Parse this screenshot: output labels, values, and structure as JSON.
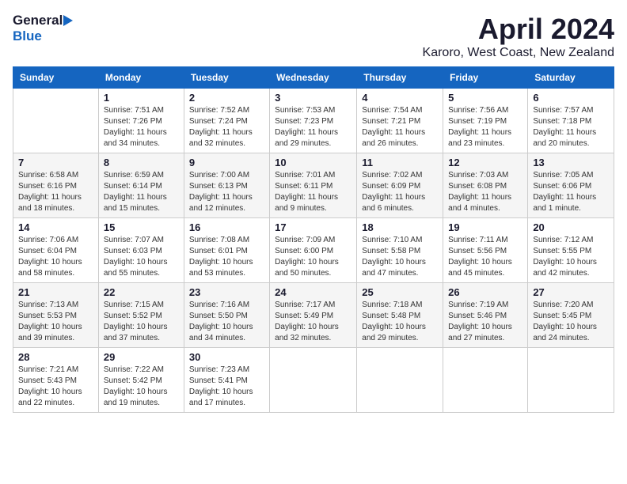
{
  "header": {
    "logo_general": "General",
    "logo_blue": "Blue",
    "month_year": "April 2024",
    "location": "Karoro, West Coast, New Zealand"
  },
  "days_of_week": [
    "Sunday",
    "Monday",
    "Tuesday",
    "Wednesday",
    "Thursday",
    "Friday",
    "Saturday"
  ],
  "weeks": [
    [
      {
        "day": "",
        "sunrise": "",
        "sunset": "",
        "daylight": ""
      },
      {
        "day": "1",
        "sunrise": "Sunrise: 7:51 AM",
        "sunset": "Sunset: 7:26 PM",
        "daylight": "Daylight: 11 hours and 34 minutes."
      },
      {
        "day": "2",
        "sunrise": "Sunrise: 7:52 AM",
        "sunset": "Sunset: 7:24 PM",
        "daylight": "Daylight: 11 hours and 32 minutes."
      },
      {
        "day": "3",
        "sunrise": "Sunrise: 7:53 AM",
        "sunset": "Sunset: 7:23 PM",
        "daylight": "Daylight: 11 hours and 29 minutes."
      },
      {
        "day": "4",
        "sunrise": "Sunrise: 7:54 AM",
        "sunset": "Sunset: 7:21 PM",
        "daylight": "Daylight: 11 hours and 26 minutes."
      },
      {
        "day": "5",
        "sunrise": "Sunrise: 7:56 AM",
        "sunset": "Sunset: 7:19 PM",
        "daylight": "Daylight: 11 hours and 23 minutes."
      },
      {
        "day": "6",
        "sunrise": "Sunrise: 7:57 AM",
        "sunset": "Sunset: 7:18 PM",
        "daylight": "Daylight: 11 hours and 20 minutes."
      }
    ],
    [
      {
        "day": "7",
        "sunrise": "Sunrise: 6:58 AM",
        "sunset": "Sunset: 6:16 PM",
        "daylight": "Daylight: 11 hours and 18 minutes."
      },
      {
        "day": "8",
        "sunrise": "Sunrise: 6:59 AM",
        "sunset": "Sunset: 6:14 PM",
        "daylight": "Daylight: 11 hours and 15 minutes."
      },
      {
        "day": "9",
        "sunrise": "Sunrise: 7:00 AM",
        "sunset": "Sunset: 6:13 PM",
        "daylight": "Daylight: 11 hours and 12 minutes."
      },
      {
        "day": "10",
        "sunrise": "Sunrise: 7:01 AM",
        "sunset": "Sunset: 6:11 PM",
        "daylight": "Daylight: 11 hours and 9 minutes."
      },
      {
        "day": "11",
        "sunrise": "Sunrise: 7:02 AM",
        "sunset": "Sunset: 6:09 PM",
        "daylight": "Daylight: 11 hours and 6 minutes."
      },
      {
        "day": "12",
        "sunrise": "Sunrise: 7:03 AM",
        "sunset": "Sunset: 6:08 PM",
        "daylight": "Daylight: 11 hours and 4 minutes."
      },
      {
        "day": "13",
        "sunrise": "Sunrise: 7:05 AM",
        "sunset": "Sunset: 6:06 PM",
        "daylight": "Daylight: 11 hours and 1 minute."
      }
    ],
    [
      {
        "day": "14",
        "sunrise": "Sunrise: 7:06 AM",
        "sunset": "Sunset: 6:04 PM",
        "daylight": "Daylight: 10 hours and 58 minutes."
      },
      {
        "day": "15",
        "sunrise": "Sunrise: 7:07 AM",
        "sunset": "Sunset: 6:03 PM",
        "daylight": "Daylight: 10 hours and 55 minutes."
      },
      {
        "day": "16",
        "sunrise": "Sunrise: 7:08 AM",
        "sunset": "Sunset: 6:01 PM",
        "daylight": "Daylight: 10 hours and 53 minutes."
      },
      {
        "day": "17",
        "sunrise": "Sunrise: 7:09 AM",
        "sunset": "Sunset: 6:00 PM",
        "daylight": "Daylight: 10 hours and 50 minutes."
      },
      {
        "day": "18",
        "sunrise": "Sunrise: 7:10 AM",
        "sunset": "Sunset: 5:58 PM",
        "daylight": "Daylight: 10 hours and 47 minutes."
      },
      {
        "day": "19",
        "sunrise": "Sunrise: 7:11 AM",
        "sunset": "Sunset: 5:56 PM",
        "daylight": "Daylight: 10 hours and 45 minutes."
      },
      {
        "day": "20",
        "sunrise": "Sunrise: 7:12 AM",
        "sunset": "Sunset: 5:55 PM",
        "daylight": "Daylight: 10 hours and 42 minutes."
      }
    ],
    [
      {
        "day": "21",
        "sunrise": "Sunrise: 7:13 AM",
        "sunset": "Sunset: 5:53 PM",
        "daylight": "Daylight: 10 hours and 39 minutes."
      },
      {
        "day": "22",
        "sunrise": "Sunrise: 7:15 AM",
        "sunset": "Sunset: 5:52 PM",
        "daylight": "Daylight: 10 hours and 37 minutes."
      },
      {
        "day": "23",
        "sunrise": "Sunrise: 7:16 AM",
        "sunset": "Sunset: 5:50 PM",
        "daylight": "Daylight: 10 hours and 34 minutes."
      },
      {
        "day": "24",
        "sunrise": "Sunrise: 7:17 AM",
        "sunset": "Sunset: 5:49 PM",
        "daylight": "Daylight: 10 hours and 32 minutes."
      },
      {
        "day": "25",
        "sunrise": "Sunrise: 7:18 AM",
        "sunset": "Sunset: 5:48 PM",
        "daylight": "Daylight: 10 hours and 29 minutes."
      },
      {
        "day": "26",
        "sunrise": "Sunrise: 7:19 AM",
        "sunset": "Sunset: 5:46 PM",
        "daylight": "Daylight: 10 hours and 27 minutes."
      },
      {
        "day": "27",
        "sunrise": "Sunrise: 7:20 AM",
        "sunset": "Sunset: 5:45 PM",
        "daylight": "Daylight: 10 hours and 24 minutes."
      }
    ],
    [
      {
        "day": "28",
        "sunrise": "Sunrise: 7:21 AM",
        "sunset": "Sunset: 5:43 PM",
        "daylight": "Daylight: 10 hours and 22 minutes."
      },
      {
        "day": "29",
        "sunrise": "Sunrise: 7:22 AM",
        "sunset": "Sunset: 5:42 PM",
        "daylight": "Daylight: 10 hours and 19 minutes."
      },
      {
        "day": "30",
        "sunrise": "Sunrise: 7:23 AM",
        "sunset": "Sunset: 5:41 PM",
        "daylight": "Daylight: 10 hours and 17 minutes."
      },
      {
        "day": "",
        "sunrise": "",
        "sunset": "",
        "daylight": ""
      },
      {
        "day": "",
        "sunrise": "",
        "sunset": "",
        "daylight": ""
      },
      {
        "day": "",
        "sunrise": "",
        "sunset": "",
        "daylight": ""
      },
      {
        "day": "",
        "sunrise": "",
        "sunset": "",
        "daylight": ""
      }
    ]
  ]
}
